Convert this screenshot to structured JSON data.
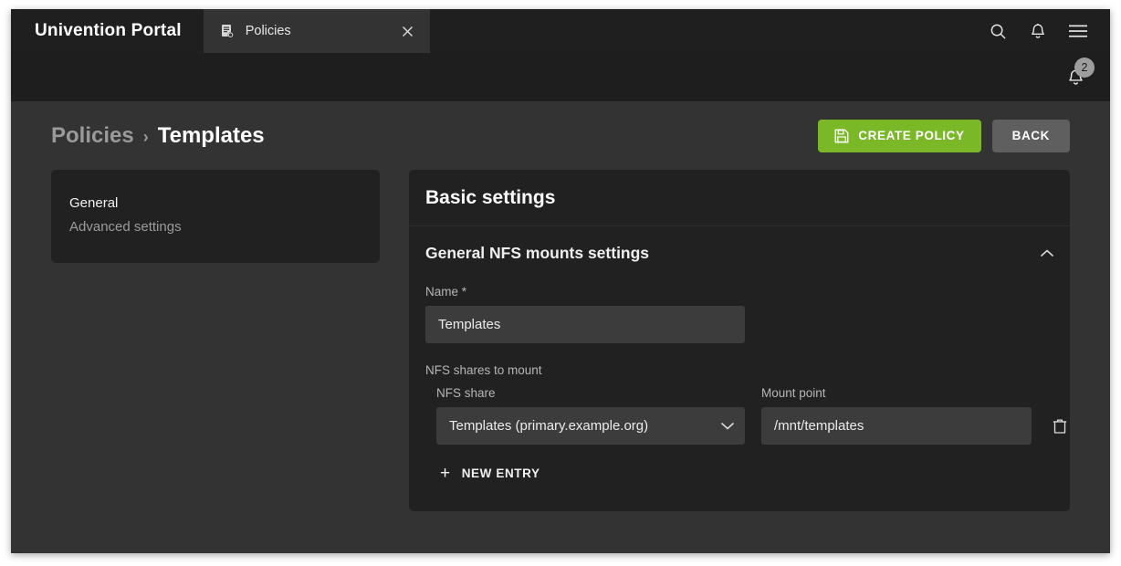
{
  "browser": {
    "brand": "Univention Portal",
    "tabs": [
      {
        "label": "Policies",
        "icon": "document-policy-icon",
        "close_icon": "close-icon"
      }
    ],
    "actions": [
      {
        "name": "search-icon",
        "label": "Search"
      },
      {
        "name": "bell-icon",
        "label": "Notifications"
      },
      {
        "name": "hamburger-menu-icon",
        "label": "Menu"
      }
    ]
  },
  "appbar": {
    "notification_icon": "bell-icon",
    "notification_count": "2"
  },
  "page": {
    "breadcrumb": {
      "parent": "Policies",
      "separator": "›",
      "current": "Templates"
    },
    "actions": {
      "create_label": "CREATE POLICY",
      "create_icon": "save-disk-icon",
      "back_label": "BACK"
    },
    "accent_green": "#7ab828",
    "secondary_grey": "#5f5f5f"
  },
  "sidebar": {
    "items": [
      {
        "label": "General",
        "active": true
      },
      {
        "label": "Advanced settings",
        "active": false
      }
    ]
  },
  "main": {
    "card_title": "Basic settings",
    "section": {
      "title": "General NFS mounts settings",
      "toggle_icon": "chevron-up-icon",
      "expanded": true
    },
    "name_field": {
      "label": "Name *",
      "value": "Templates",
      "placeholder": ""
    },
    "shares": {
      "group_label": "NFS shares to mount",
      "columns": {
        "share": "NFS share",
        "mount": "Mount point"
      },
      "rows": [
        {
          "share": "Templates (primary.example.org)",
          "share_caret_icon": "chevron-down-icon",
          "mount": "/mnt/templates",
          "mount_placeholder": "",
          "delete_icon": "trash-icon"
        }
      ],
      "new_entry_label": "NEW ENTRY",
      "new_entry_icon": "plus-icon"
    }
  }
}
